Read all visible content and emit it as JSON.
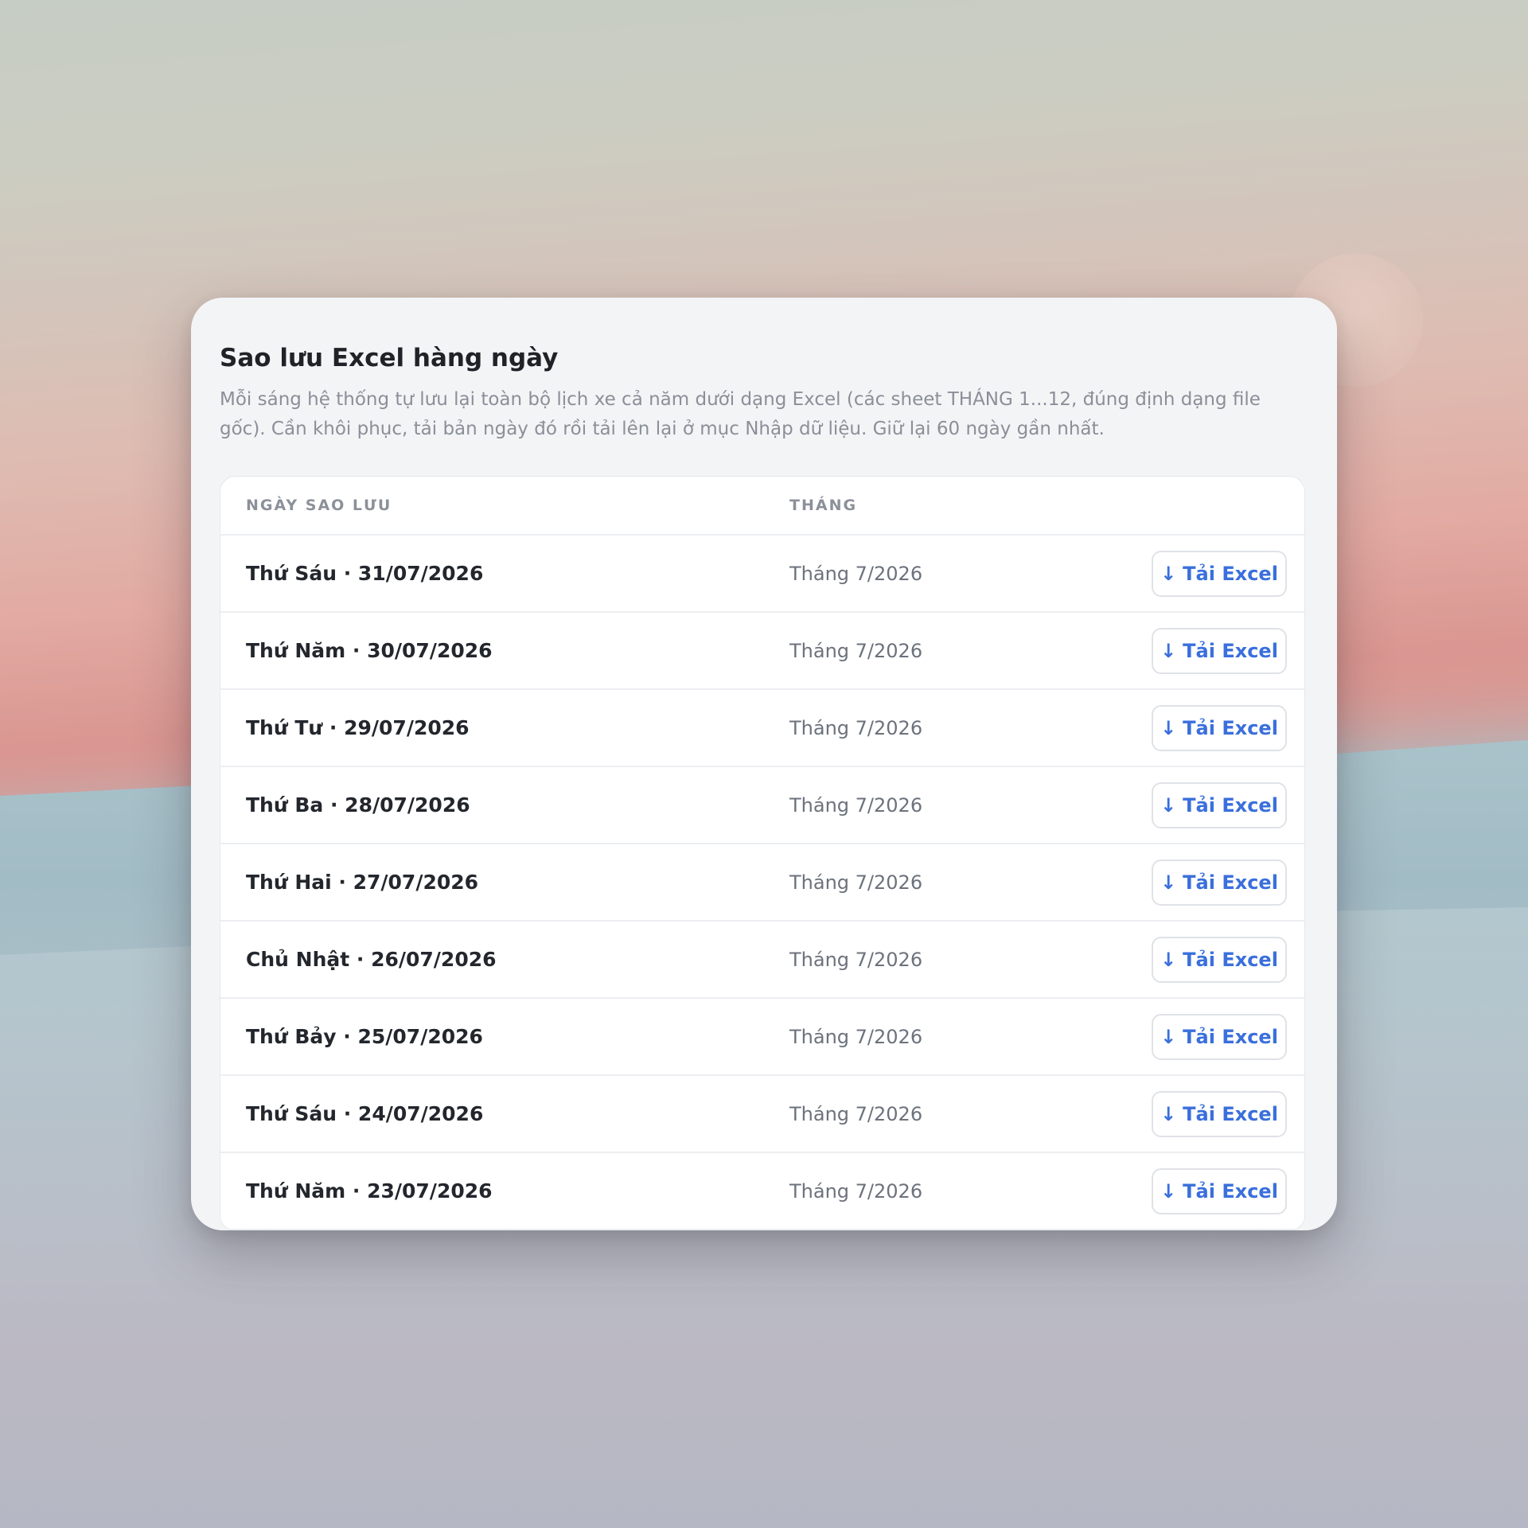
{
  "panel": {
    "title": "Sao lưu Excel hàng ngày",
    "description": "Mỗi sáng hệ thống tự lưu lại toàn bộ lịch xe cả năm dưới dạng Excel (các sheet THÁNG 1...12, đúng định dạng file gốc). Cần khôi phục, tải bản ngày đó rồi tải lên lại ở mục Nhập dữ liệu. Giữ lại 60 ngày gần nhất."
  },
  "table": {
    "headers": {
      "date": "NGÀY SAO LƯU",
      "month": "THÁNG"
    },
    "download_label": "Tải Excel",
    "download_icon": "download-arrow-icon",
    "accent_color": "#3a6fdc",
    "rows": [
      {
        "date": "Thứ Sáu · 31/07/2026",
        "month": "Tháng 7/2026"
      },
      {
        "date": "Thứ Năm · 30/07/2026",
        "month": "Tháng 7/2026"
      },
      {
        "date": "Thứ Tư · 29/07/2026",
        "month": "Tháng 7/2026"
      },
      {
        "date": "Thứ Ba · 28/07/2026",
        "month": "Tháng 7/2026"
      },
      {
        "date": "Thứ Hai · 27/07/2026",
        "month": "Tháng 7/2026"
      },
      {
        "date": "Chủ Nhật · 26/07/2026",
        "month": "Tháng 7/2026"
      },
      {
        "date": "Thứ Bảy · 25/07/2026",
        "month": "Tháng 7/2026"
      },
      {
        "date": "Thứ Sáu · 24/07/2026",
        "month": "Tháng 7/2026"
      },
      {
        "date": "Thứ Năm · 23/07/2026",
        "month": "Tháng 7/2026"
      }
    ]
  }
}
